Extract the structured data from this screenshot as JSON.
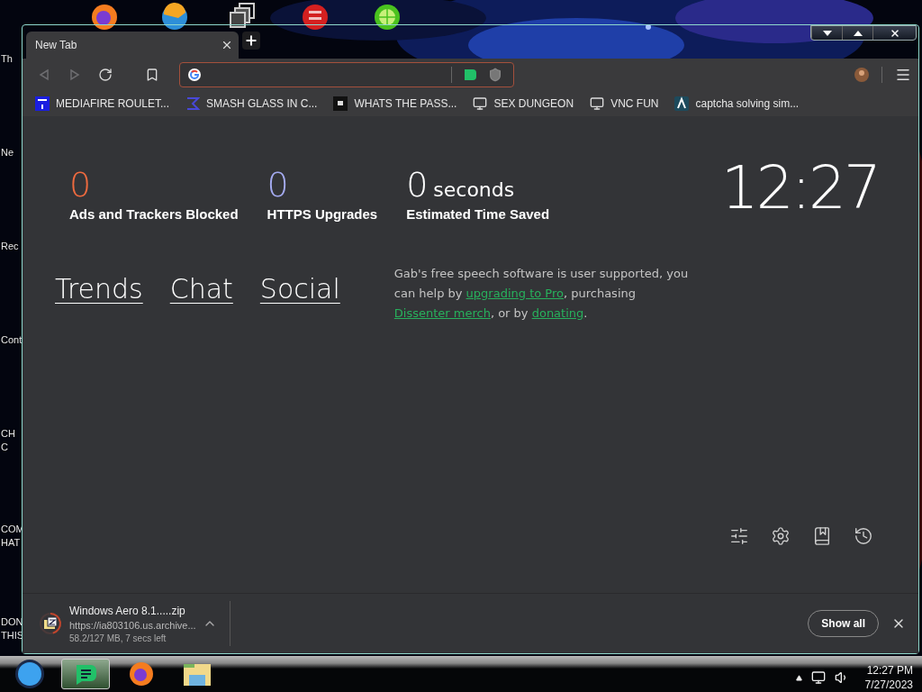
{
  "desktop": {
    "top_icons": [
      {
        "kind": "firefox"
      },
      {
        "kind": "edge"
      },
      {
        "kind": "windows"
      },
      {
        "kind": "devcpp"
      },
      {
        "kind": "lime"
      }
    ],
    "left_labels": [
      {
        "lines": [
          "Th"
        ]
      },
      {
        "lines": [
          "Ne"
        ]
      },
      {
        "lines": [
          "Rec"
        ]
      },
      {
        "lines": [
          "Cont"
        ]
      },
      {
        "lines": [
          "CH",
          "C"
        ]
      },
      {
        "lines": [
          "COM",
          "HAT"
        ]
      },
      {
        "lines": [
          "DON",
          "THIS"
        ]
      }
    ]
  },
  "browser": {
    "tab": {
      "title": "New Tab"
    },
    "nav": [
      {
        "kind": "back",
        "disabled": true
      },
      {
        "kind": "forward",
        "disabled": true
      },
      {
        "kind": "reload",
        "disabled": false
      }
    ],
    "bookmarks": [
      {
        "kind": "mft",
        "label": "MEDIAFIRE ROULET..."
      },
      {
        "kind": "sigma",
        "label": "SMASH GLASS IN C..."
      },
      {
        "kind": "dark",
        "label": "WHATS THE PASS..."
      },
      {
        "kind": "computer",
        "label": "SEX DUNGEON"
      },
      {
        "kind": "computer",
        "label": "VNC FUN"
      },
      {
        "kind": "lambda",
        "label": "captcha solving sim..."
      }
    ],
    "stats": [
      {
        "value": "0",
        "label": "Ads and Trackers Blocked",
        "color": "#ee6a3f"
      },
      {
        "value": "0",
        "label": "HTTPS Upgrades",
        "color": "#a4aaf0"
      },
      {
        "value": "0",
        "unit": "seconds",
        "label": "Estimated Time Saved",
        "color": "#ffffff"
      }
    ],
    "clock": "12:27",
    "nav_links": [
      "Trends",
      "Chat",
      "Social"
    ],
    "support_text": [
      {
        "text": "Gab's free speech software is user supported, you can help by "
      },
      {
        "text": "upgrading to Pro",
        "link": true
      },
      {
        "text": ", purchasing "
      },
      {
        "text": "Dissenter merch",
        "link": true
      },
      {
        "text": ", or by "
      },
      {
        "text": "donating",
        "link": true
      },
      {
        "text": "."
      }
    ],
    "download": {
      "filename": "Windows Aero 8.1.....zip",
      "url": "https://ia803106.us.archive...",
      "status": "58.2/127 MB, 7 secs left"
    },
    "show_all": "Show all"
  },
  "taskbar": {
    "apps": [
      {
        "kind": "start",
        "selected": false
      },
      {
        "kind": "gab",
        "selected": true
      },
      {
        "kind": "firefox",
        "selected": false
      },
      {
        "kind": "explorer",
        "selected": false
      }
    ],
    "time": "12:27 PM",
    "date": "7/27/2023"
  }
}
